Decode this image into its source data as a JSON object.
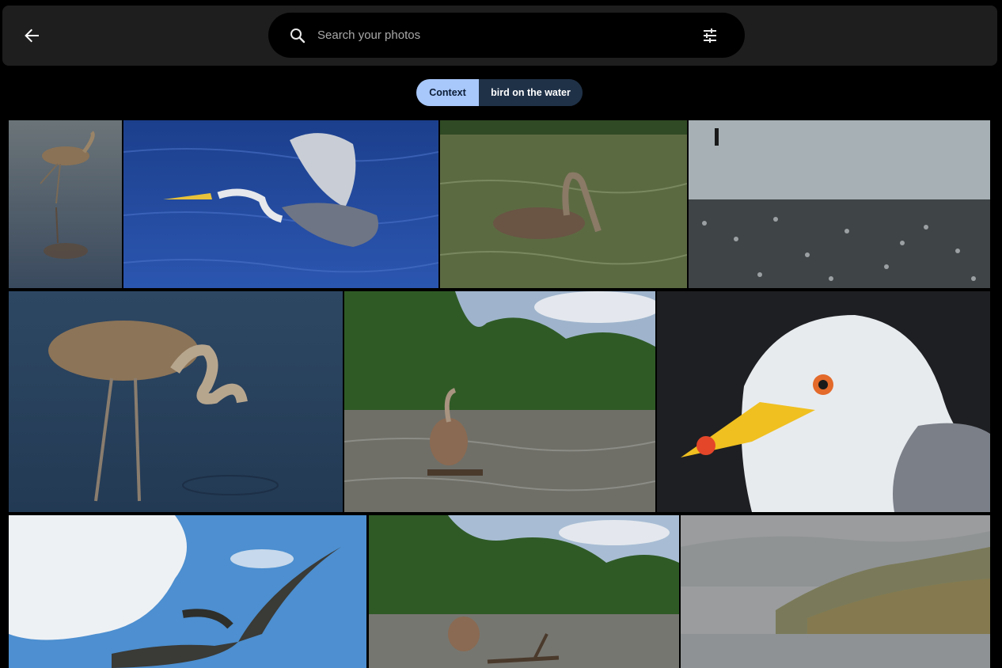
{
  "header": {
    "back_icon": "arrow-back-icon",
    "search": {
      "placeholder": "Search your photos",
      "value": "",
      "icon": "search-icon",
      "filter_icon": "tune-icon"
    }
  },
  "chips": {
    "context_label": "Context",
    "query_label": "bird on the water",
    "active": "context",
    "active_color": "#a8c7fa"
  },
  "photos": [
    {
      "subject": "flamingo standing with reflection"
    },
    {
      "subject": "heron flying over blue water"
    },
    {
      "subject": "pelican swimming in green water"
    },
    {
      "subject": "flock of birds on water with wading figure"
    },
    {
      "subject": "juvenile flamingo wading"
    },
    {
      "subject": "pelican standing in river by trees"
    },
    {
      "subject": "gull head close-up"
    },
    {
      "subject": "pelican flying against sky"
    },
    {
      "subject": "pelican standing on log in river"
    },
    {
      "subject": "misty lake with reeds"
    }
  ]
}
